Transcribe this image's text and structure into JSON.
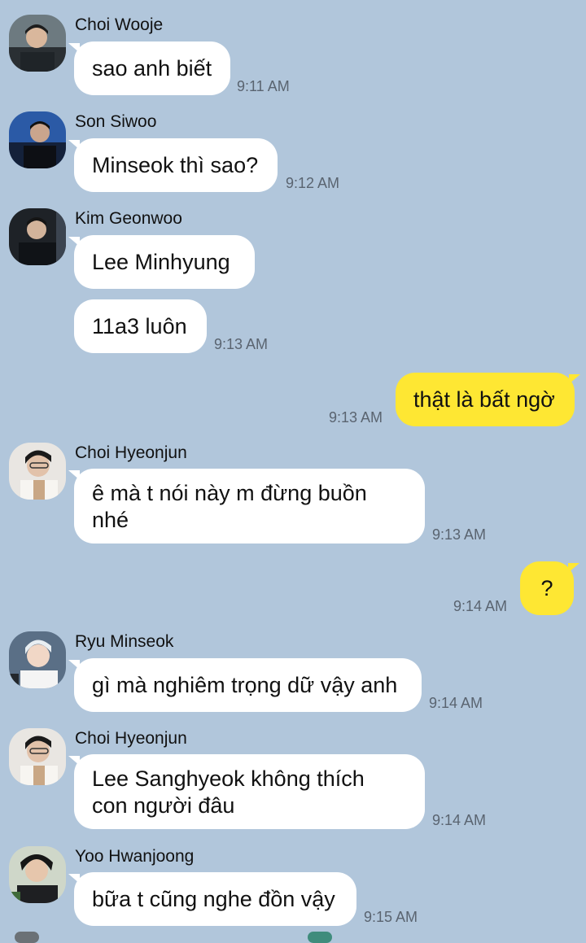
{
  "messages": [
    {
      "sender": "Choi Wooje",
      "text": "sao anh biết",
      "time": "9:11 AM"
    },
    {
      "sender": "Son Siwoo",
      "text": "Minseok thì sao?",
      "time": "9:12 AM"
    },
    {
      "sender": "Kim Geonwoo",
      "text": "Lee Minhyung"
    },
    {
      "text": "11a3 luôn",
      "time": "9:13 AM"
    },
    {
      "text": "thật là bất ngờ",
      "time": "9:13 AM"
    },
    {
      "sender": "Choi Hyeonjun",
      "line1": "ê mà t nói này m đừng buồn",
      "line2": "nhé",
      "time": "9:13 AM"
    },
    {
      "text": "?",
      "time": "9:14 AM"
    },
    {
      "sender": "Ryu Minseok",
      "text": "gì mà nghiêm trọng dữ vậy anh",
      "time": "9:14 AM"
    },
    {
      "sender": "Choi Hyeonjun",
      "line1": "Lee Sanghyeok không thích",
      "line2": "con người đâu",
      "time": "9:14 AM"
    },
    {
      "sender": "Yoo Hwanjoong",
      "text": "bữa t cũng nghe đồn vậy",
      "time": "9:15 AM"
    }
  ],
  "colors": {
    "background": "#b1c6db",
    "incoming_bubble": "#ffffff",
    "outgoing_bubble": "#fee733",
    "timestamp": "#5a6470"
  }
}
